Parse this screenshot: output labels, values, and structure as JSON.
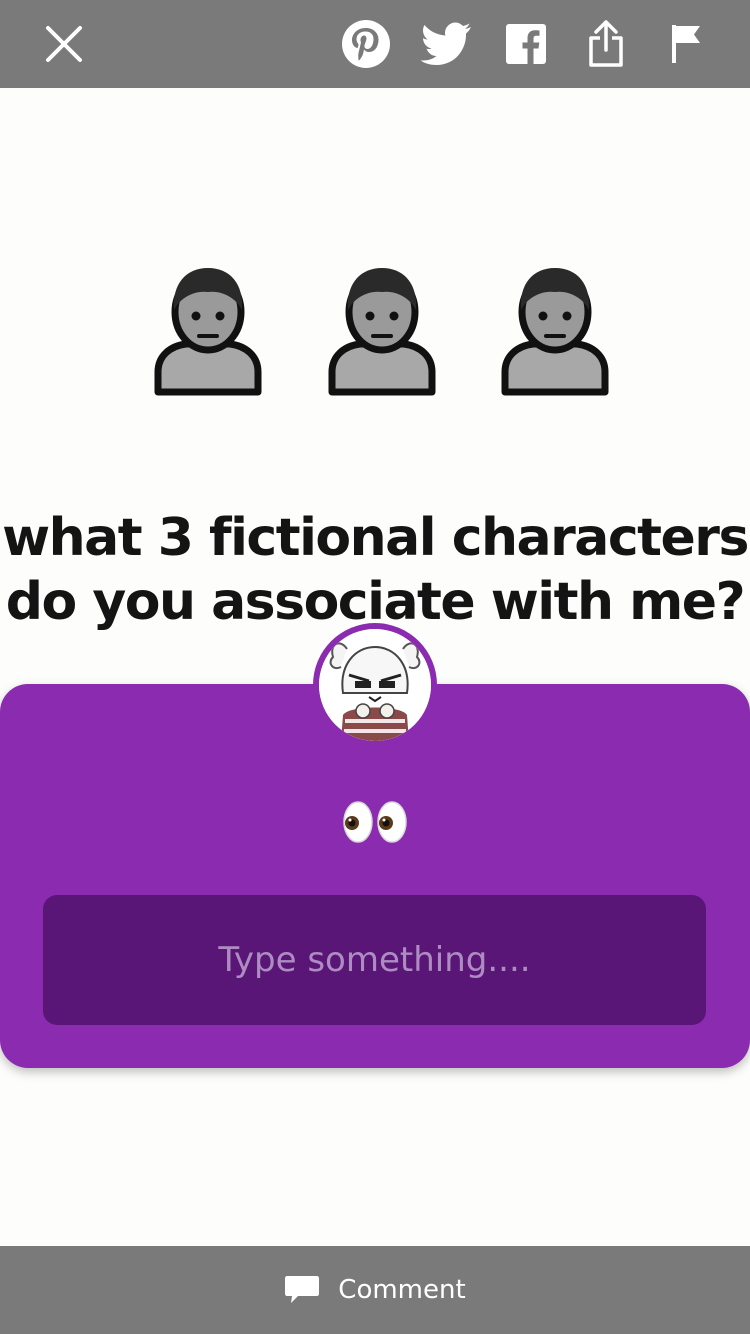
{
  "topbar": {
    "icons": [
      "close-icon",
      "pinterest-icon",
      "twitter-icon",
      "facebook-icon",
      "share-icon",
      "flag-icon"
    ]
  },
  "post": {
    "headline_line1": "what 3 fictional characters",
    "headline_line2": "do you associate with me?",
    "people_icons": [
      "person-icon",
      "person-icon",
      "person-icon"
    ]
  },
  "question_card": {
    "emoji": "👀",
    "input_placeholder": "Type something....",
    "colors": {
      "card": "#8a2bb0",
      "input": "#5a1676"
    }
  },
  "bottombar": {
    "comment_label": "Comment"
  }
}
